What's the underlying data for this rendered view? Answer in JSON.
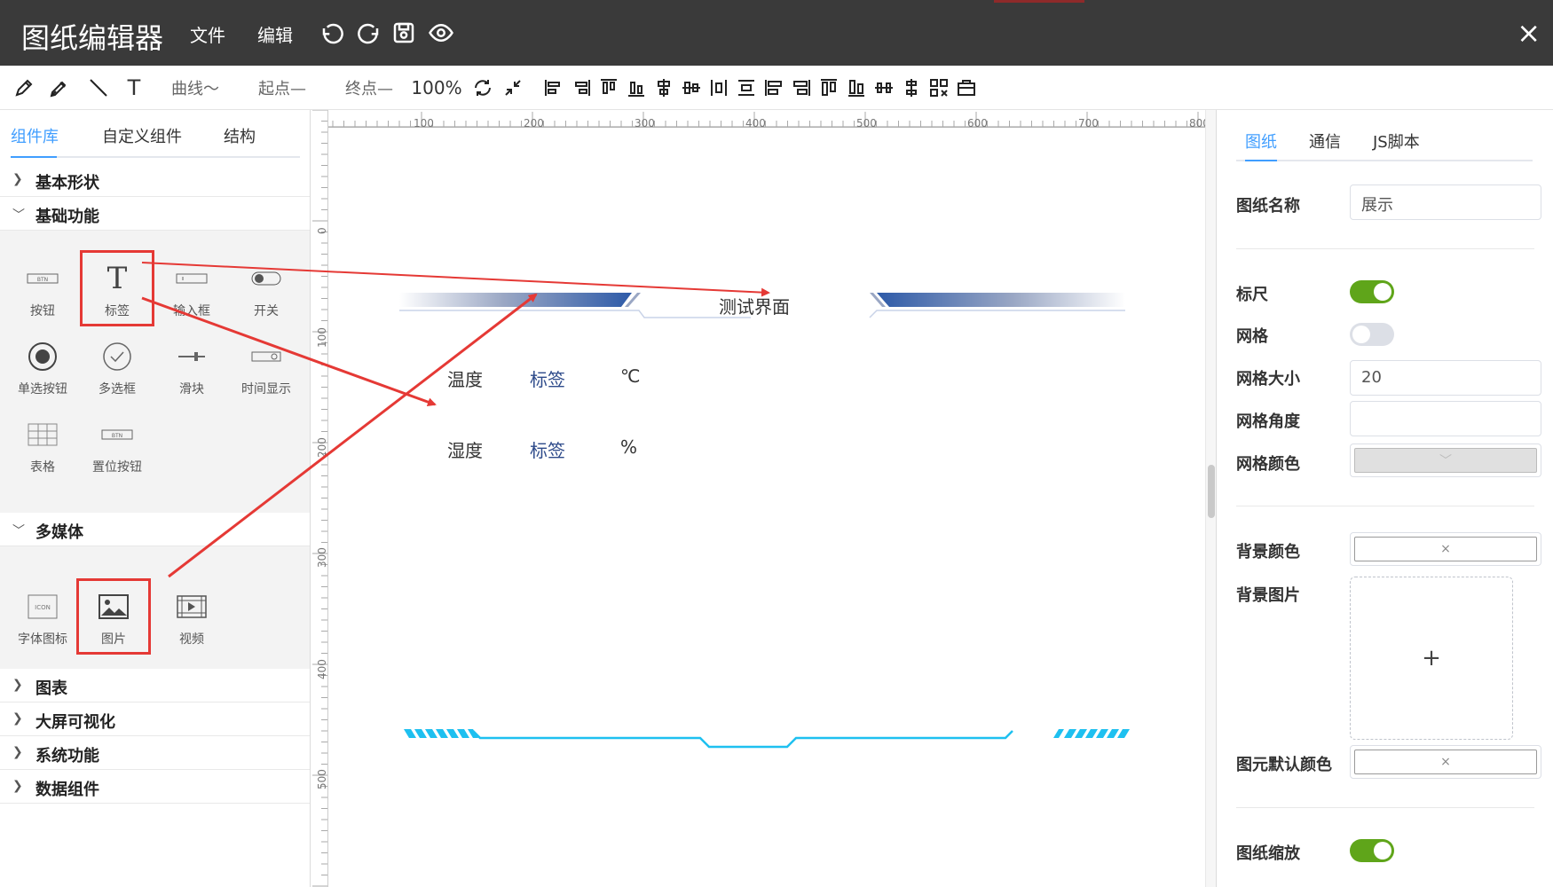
{
  "app": {
    "title": "图纸编辑器",
    "close_label": "×"
  },
  "menu": {
    "file": "文件",
    "edit": "编辑"
  },
  "toolbar": {
    "curve": "曲线～",
    "start": "起点—",
    "end": "终点—",
    "zoom": "100%"
  },
  "left_tabs": [
    "组件库",
    "自定义组件",
    "结构"
  ],
  "sections": {
    "basic_shapes": "基本形状",
    "basic_functions": "基础功能",
    "multimedia": "多媒体",
    "charts": "图表",
    "bigscreen": "大屏可视化",
    "system": "系统功能",
    "data": "数据组件"
  },
  "basic_components": [
    "按钮",
    "标签",
    "输入框",
    "开关",
    "单选按钮",
    "多选框",
    "滑块",
    "时间显示",
    "表格",
    "置位按钮"
  ],
  "multimedia_components": [
    "字体图标",
    "图片",
    "视频"
  ],
  "icon_text": {
    "btn": "BTN",
    "icon": "ICON",
    "t": "T"
  },
  "ruler": {
    "h": [
      "100",
      "200",
      "300",
      "400",
      "500",
      "600",
      "700",
      "800"
    ],
    "v": [
      "0",
      "100",
      "200",
      "300",
      "400",
      "500"
    ]
  },
  "canvas": {
    "heading": "测试界面",
    "rows": [
      {
        "label": "温度",
        "value": "标签",
        "unit": "℃"
      },
      {
        "label": "湿度",
        "value": "标签",
        "unit": "%"
      }
    ]
  },
  "right_tabs": [
    "图纸",
    "通信",
    "JS脚本"
  ],
  "props": {
    "name_label": "图纸名称",
    "name_value": "展示",
    "ruler_label": "标尺",
    "ruler_on": true,
    "grid_label": "网格",
    "grid_on": false,
    "grid_size_label": "网格大小",
    "grid_size_value": "20",
    "grid_angle_label": "网格角度",
    "grid_angle_value": "",
    "grid_color_label": "网格颜色",
    "bg_color_label": "背景颜色",
    "bg_image_label": "背景图片",
    "default_color_label": "图元默认颜色",
    "scale_label": "图纸缩放",
    "scale_on": true,
    "clear_glyph": "×",
    "add_glyph": "+",
    "dropdown_glyph": "﹀"
  },
  "colors": {
    "accent": "#409eff",
    "toggle_on": "#5fa51a",
    "toggle_off": "#dcdfe6",
    "annotation": "#e53935",
    "banner_blue": "#2d5aa8",
    "deco_cyan": "#1ec0f0",
    "label_blue": "#2d4a8a"
  }
}
